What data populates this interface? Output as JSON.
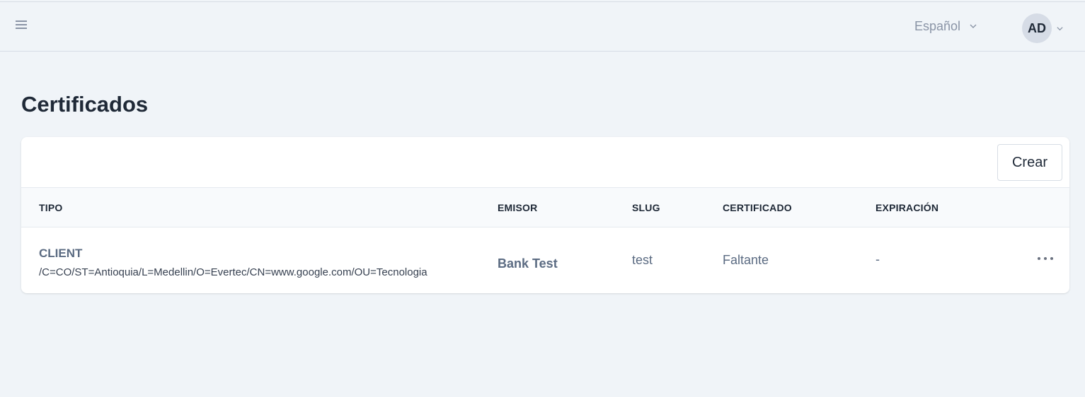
{
  "header": {
    "menu_icon": "hamburger-icon",
    "language": "Español",
    "user_initials": "AD"
  },
  "page": {
    "title": "Certificados"
  },
  "toolbar": {
    "create_label": "Crear"
  },
  "table": {
    "columns": [
      "TIPO",
      "EMISOR",
      "SLUG",
      "CERTIFICADO",
      "EXPIRACIÓN"
    ],
    "rows": [
      {
        "tipo": "CLIENT",
        "subject": "/C=CO/ST=Antioquia/L=Medellin/O=Evertec/CN=www.google.com/OU=Tecnologia",
        "emisor": "Bank Test",
        "slug": "test",
        "certificado": "Faltante",
        "expiracion": "-",
        "actions_icon": "more-horizontal-icon"
      }
    ]
  }
}
